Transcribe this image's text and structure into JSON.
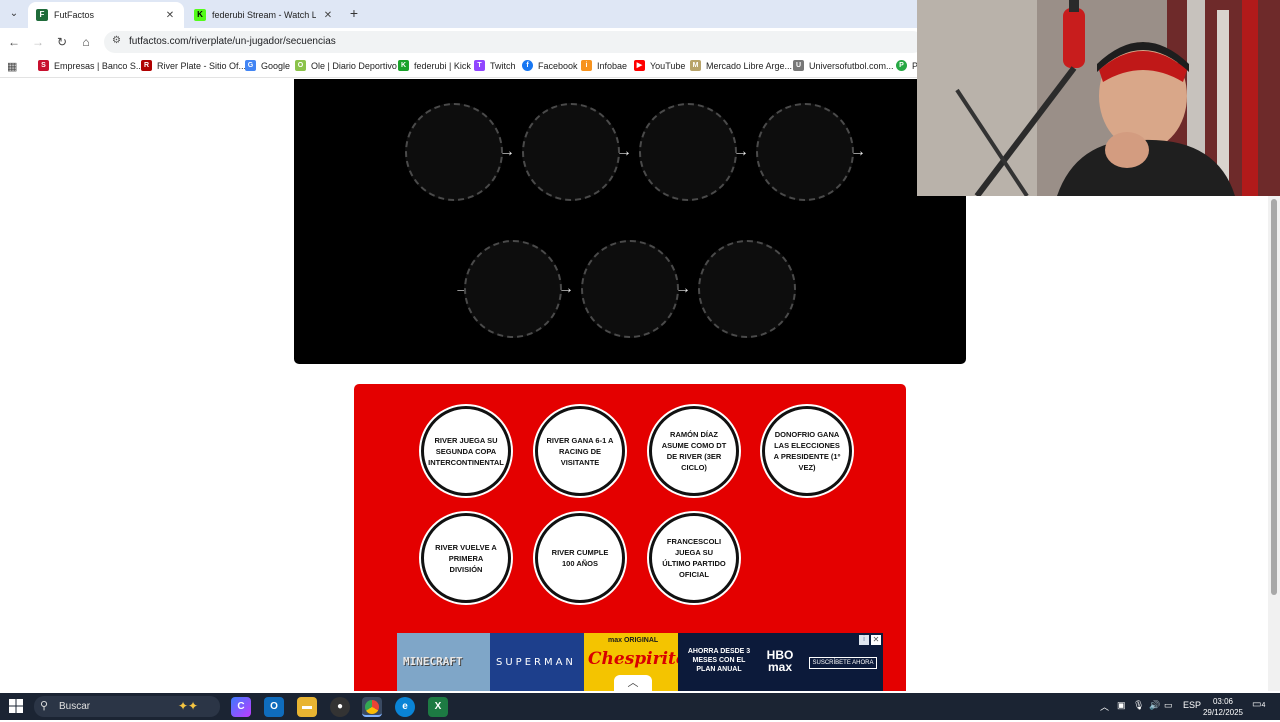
{
  "browser": {
    "tabs": [
      {
        "title": "FutFactos",
        "active": true,
        "favicon_color": "#1f6b3a"
      },
      {
        "title": "federubi Stream - Watch Live o",
        "active": false,
        "favicon_color": "#53fc18"
      }
    ],
    "url": "futfactos.com/riverplate/un-jugador/secuencias",
    "bookmarks": [
      {
        "label": "Empresas | Banco S...",
        "icon": "bank-icon",
        "color": "#c8102e"
      },
      {
        "label": "River Plate - Sitio Of...",
        "icon": "river-crest-icon",
        "color": "#b00000"
      },
      {
        "label": "Google",
        "icon": "google-icon",
        "color": "#4285f4"
      },
      {
        "label": "Ole | Diario Deportivo",
        "icon": "ole-icon",
        "color": "#8bc34a"
      },
      {
        "label": "federubi | Kick",
        "icon": "kick-icon",
        "color": "#1aa32a"
      },
      {
        "label": "Twitch",
        "icon": "twitch-icon",
        "color": "#9146ff"
      },
      {
        "label": "Facebook",
        "icon": "facebook-icon",
        "color": "#1877f2"
      },
      {
        "label": "Infobae",
        "icon": "infobae-icon",
        "color": "#f7931e"
      },
      {
        "label": "YouTube",
        "icon": "youtube-icon",
        "color": "#ff0000"
      },
      {
        "label": "Mercado Libre Arge...",
        "icon": "mercadolibre-icon",
        "color": "#b8a46a"
      },
      {
        "label": "Universofutbol.com...",
        "icon": "universofutbol-icon",
        "color": "#777777"
      },
      {
        "label": "PE",
        "icon": "pe-icon",
        "color": "#27a844"
      }
    ]
  },
  "sequence_slots": {
    "row1_count": 4,
    "row2_count": 3,
    "arrow_glyph": "→"
  },
  "events": [
    {
      "label": "RIVER JUEGA SU SEGUNDA COPA INTERCONTINENTAL"
    },
    {
      "label": "RIVER GANA 6-1 A RACING DE VISITANTE"
    },
    {
      "label": "RAMÓN DÍAZ ASUME COMO DT DE RIVER (3ER CICLO)"
    },
    {
      "label": "DONOFRIO GANA LAS ELECCIONES A PRESIDENTE (1º VEZ)"
    },
    {
      "label": "RIVER VUELVE A PRIMERA DIVISIÓN"
    },
    {
      "label": "RIVER CUMPLE 100 AÑOS"
    },
    {
      "label": "FRANCESCOLI JUEGA SU ÚLTIMO PARTIDO OFICIAL"
    }
  ],
  "ad": {
    "tiles": [
      {
        "text": "MINECRAFT",
        "bg": "#7fa6c8"
      },
      {
        "text": "SUPERMAN",
        "bg": "#1d3f8c"
      },
      {
        "text": "Chespirito",
        "top": "max ORIGINAL",
        "bg": "#f4c400"
      },
      {
        "text": "AHORRA DESDE 3 MESES CON EL PLAN ANUAL",
        "bg": "#0c1a3a"
      },
      {
        "text": "HBO max",
        "bg": "#0c1a3a"
      },
      {
        "text": "SUSCRÍBETE AHORA",
        "bg": "#0c1a3a"
      }
    ],
    "close_glyph": "✕",
    "info_glyph": "i"
  },
  "taskbar": {
    "search_placeholder": "Buscar",
    "language": "ESP",
    "time": "03:06",
    "date": "29/12/2025",
    "notifications": "4"
  },
  "colors": {
    "black_panel": "#000000",
    "red_panel": "#e40000",
    "accent_tab_bar": "#dfe7f5"
  }
}
